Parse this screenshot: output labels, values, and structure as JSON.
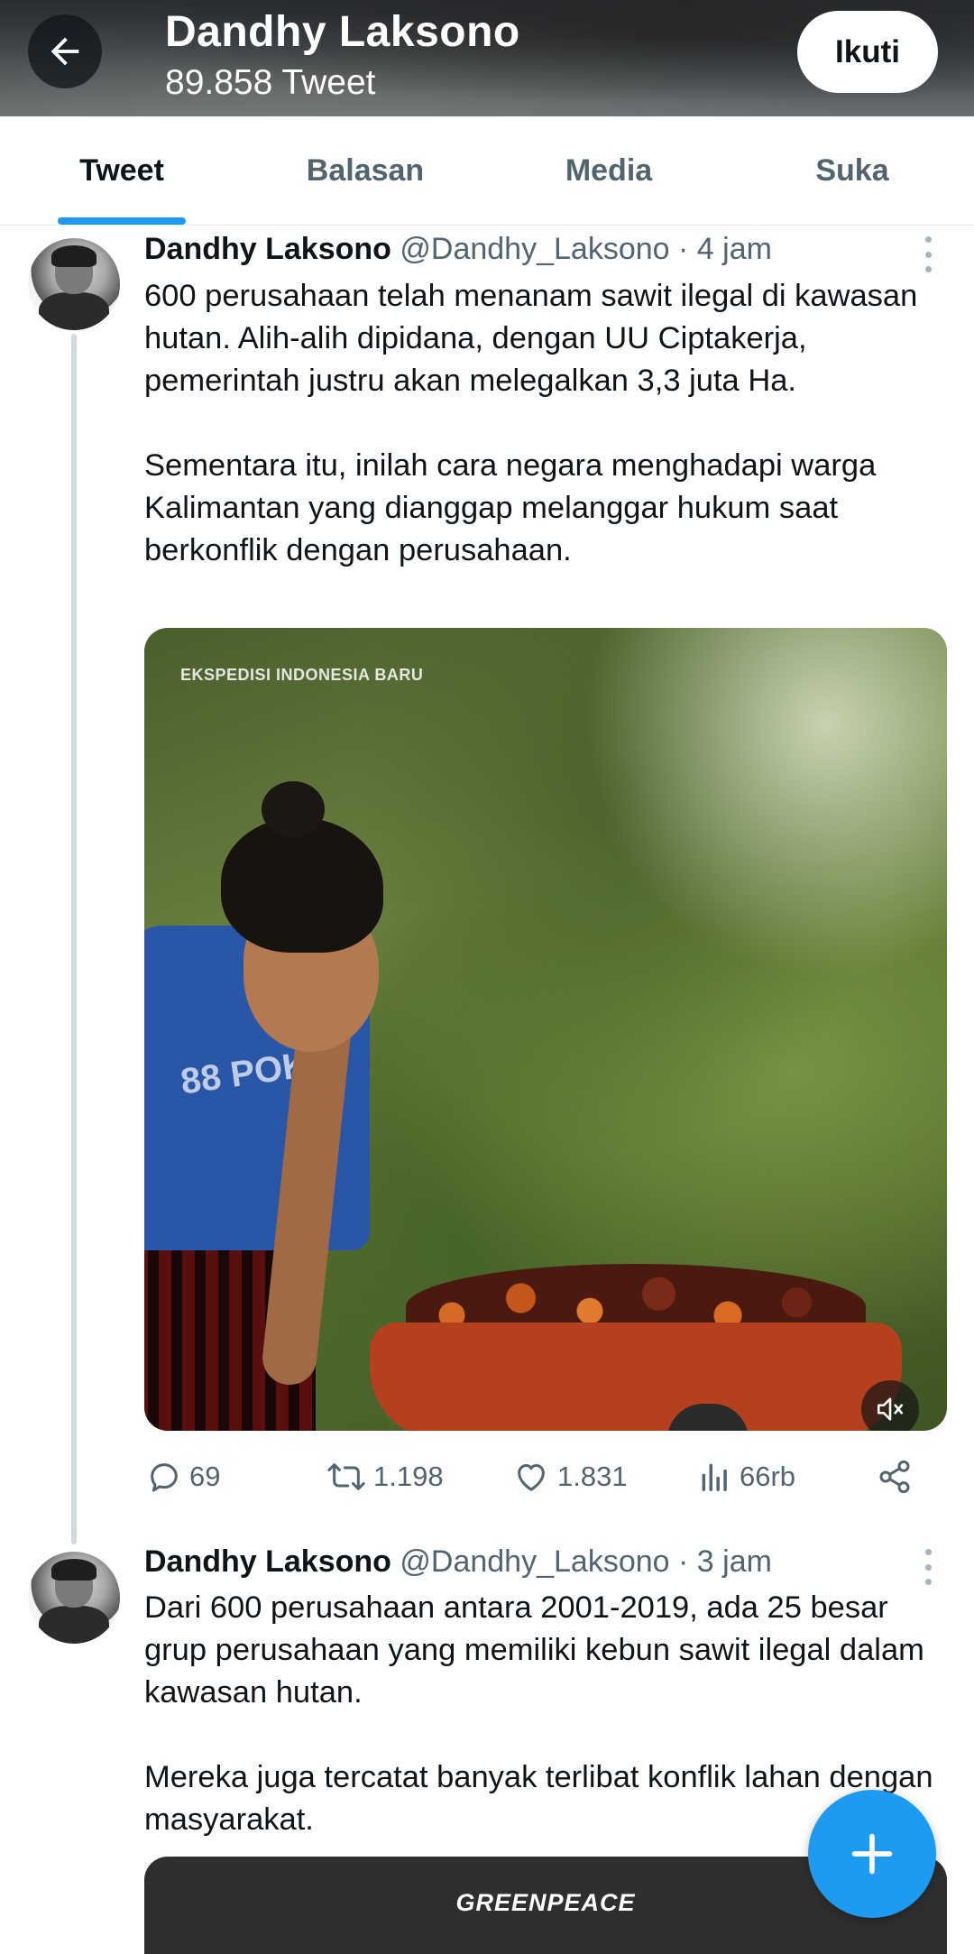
{
  "header": {
    "title": "Dandhy Laksono",
    "tweet_count": "89.858 Tweet",
    "follow_label": "Ikuti"
  },
  "tabs": [
    {
      "label": "Tweet",
      "active": true
    },
    {
      "label": "Balasan",
      "active": false
    },
    {
      "label": "Media",
      "active": false
    },
    {
      "label": "Suka",
      "active": false
    }
  ],
  "tweets": [
    {
      "name": "Dandhy Laksono",
      "handle": "@Dandhy_Laksono",
      "time": "· 4 jam",
      "paragraphs": [
        "600 perusahaan telah menanam sawit ilegal di kawasan hutan. Alih-alih dipidana, dengan UU Ciptakerja, pemerintah justru akan melegalkan 3,3 juta Ha.",
        "Sementara itu, inilah cara negara menghadapi warga Kalimantan yang dianggap melanggar hukum saat berkonflik dengan perusahaan."
      ],
      "media_watermark": "EKSPEDISI INDONESIA BARU",
      "shirt_print": "88 POKY",
      "replies": "69",
      "retweets": "1.198",
      "likes": "1.831",
      "views": "66rb"
    },
    {
      "name": "Dandhy Laksono",
      "handle": "@Dandhy_Laksono",
      "time": "· 3 jam",
      "paragraphs": [
        "Dari 600 perusahaan antara 2001-2019, ada 25 besar grup perusahaan yang memiliki kebun sawit ilegal dalam kawasan hutan.",
        "Mereka juga tercatat banyak terlibat konflik lahan dengan masyarakat."
      ],
      "media_logo": "GREENPEACE"
    }
  ],
  "icons": {
    "back": "arrow-left-icon",
    "more": "more-vertical-icon",
    "reply": "reply-icon",
    "retweet": "retweet-icon",
    "like": "heart-icon",
    "views": "views-icon",
    "share": "share-icon",
    "mute": "mute-icon",
    "compose": "plus-icon"
  },
  "colors": {
    "accent": "#1d9bf0",
    "text": "#0f1419",
    "muted": "#536471"
  }
}
